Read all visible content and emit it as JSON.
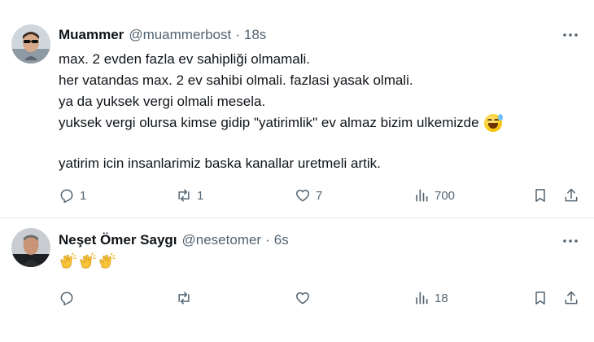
{
  "tweets": [
    {
      "author_name": "Muammer",
      "handle": "@muammerbost",
      "separator": "·",
      "time": "18s",
      "lines": [
        "max. 2 evden fazla ev sahipliği olmamali.",
        "her vatandas max. 2 ev sahibi olmali. fazlasi yasak olmali.",
        "ya da yuksek vergi olmali mesela.",
        "yuksek vergi olursa kimse gidip \"yatirimlik\" ev almaz bizim ulkemizde",
        "",
        "yatirim icin insanlarimiz baska kanallar uretmeli artik."
      ],
      "line4_emoji": "grinning-face-with-sweat",
      "replies": "1",
      "reposts": "1",
      "likes": "7",
      "views": "700"
    },
    {
      "author_name": "Neşet Ömer Saygı",
      "handle": "@nesetomer",
      "separator": "·",
      "time": "6s",
      "emojis": [
        "clapping-hands",
        "clapping-hands",
        "clapping-hands"
      ],
      "replies": "",
      "reposts": "",
      "likes": "",
      "views": "18"
    }
  ],
  "colors": {
    "text": "#0f1419",
    "secondary": "#536471",
    "divider": "#e6ecf0"
  }
}
